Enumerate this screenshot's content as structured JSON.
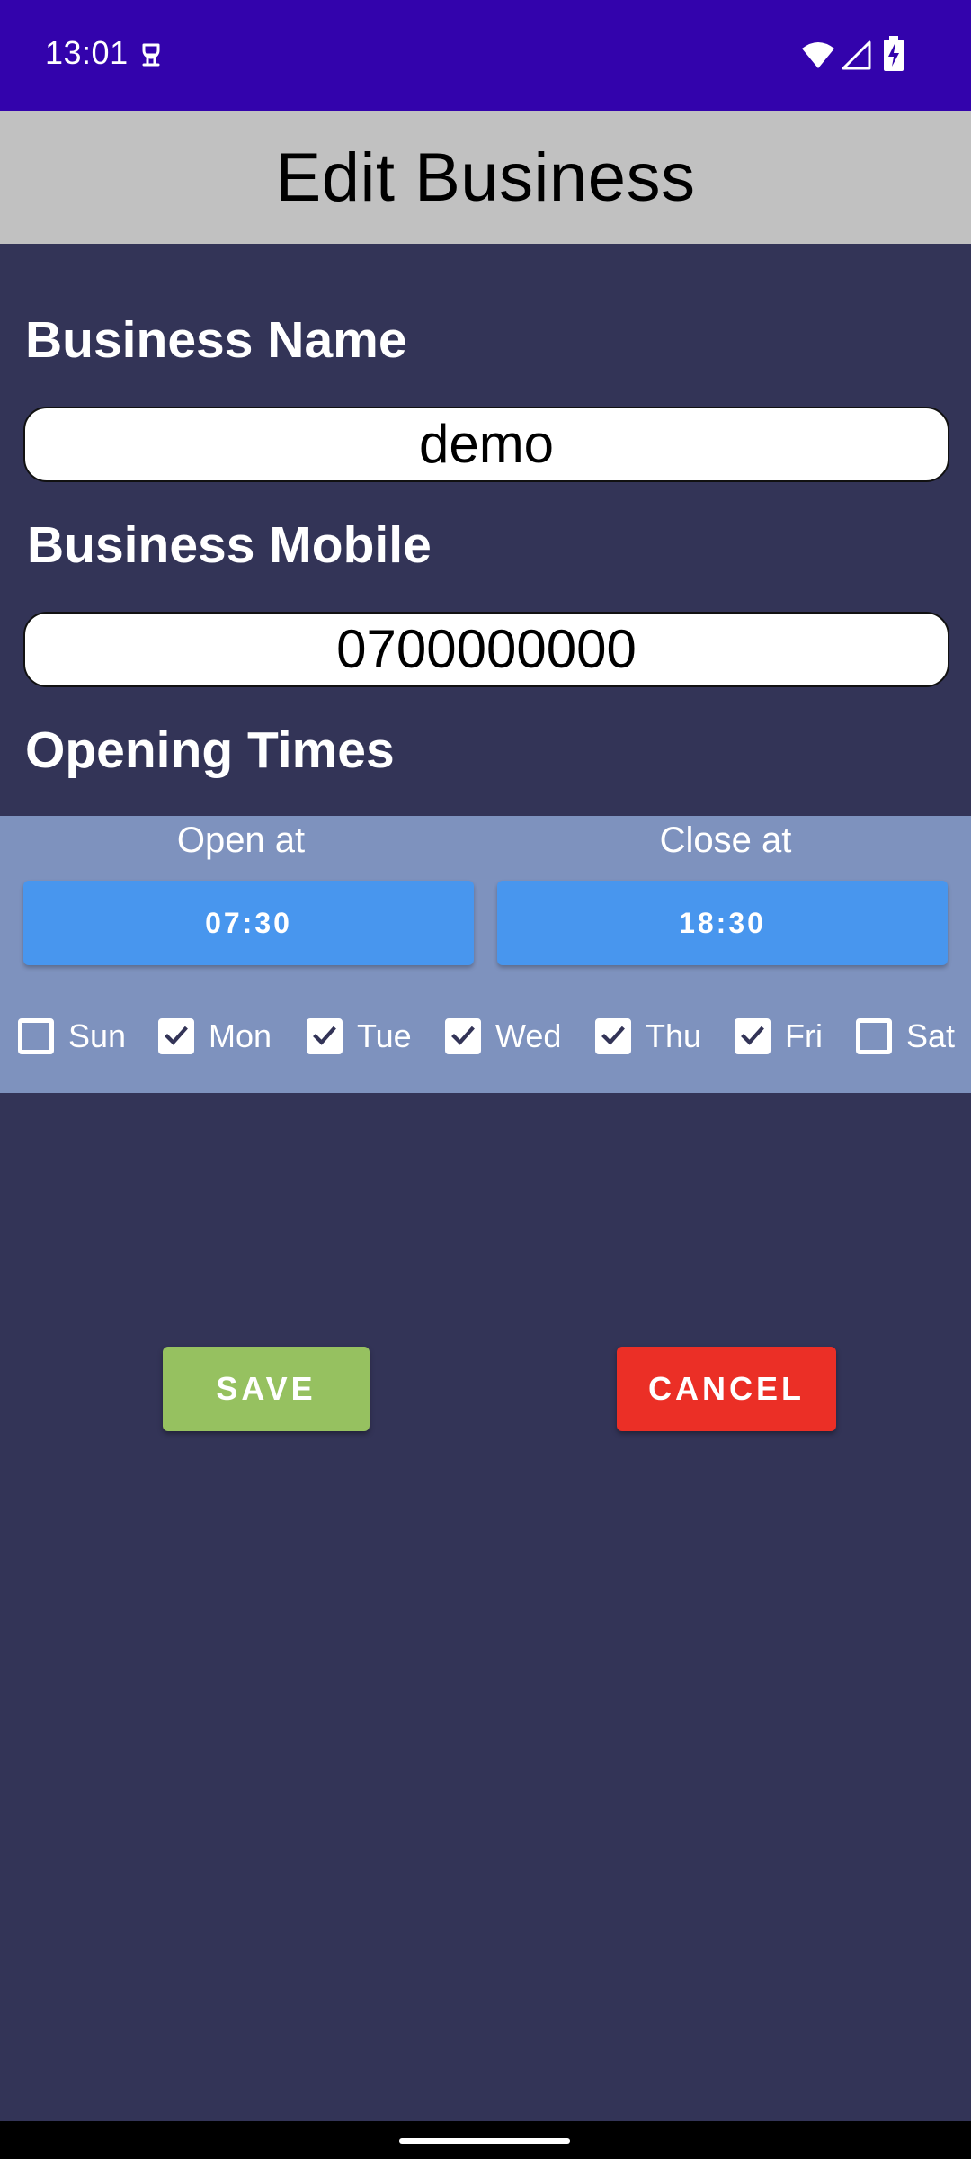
{
  "status_bar": {
    "time": "13:01",
    "background": "#3303AC",
    "icons": [
      "app-notification-icon",
      "wifi-icon",
      "signal-icon",
      "battery-charging-icon"
    ]
  },
  "header": {
    "title": "Edit Business",
    "background": "#C1C1C1"
  },
  "form": {
    "business_name_label": "Business Name",
    "business_name_value": "demo",
    "business_mobile_label": "Business Mobile",
    "business_mobile_value": "0700000000",
    "opening_times_label": "Opening Times"
  },
  "opening_times": {
    "open_label": "Open at",
    "close_label": "Close at",
    "open_time": "07:30",
    "close_time": "18:30",
    "days": [
      {
        "label": "Sun",
        "checked": false
      },
      {
        "label": "Mon",
        "checked": true
      },
      {
        "label": "Tue",
        "checked": true
      },
      {
        "label": "Wed",
        "checked": true
      },
      {
        "label": "Thu",
        "checked": true
      },
      {
        "label": "Fri",
        "checked": true
      },
      {
        "label": "Sat",
        "checked": false
      }
    ]
  },
  "actions": {
    "save_label": "SAVE",
    "cancel_label": "CANCEL"
  },
  "colors": {
    "page_background": "#333457",
    "panel_background": "#7E92BE",
    "time_button": "#4896EE",
    "save_button": "#96C160",
    "cancel_button": "#EB2F26",
    "checkmark": "#333457"
  }
}
